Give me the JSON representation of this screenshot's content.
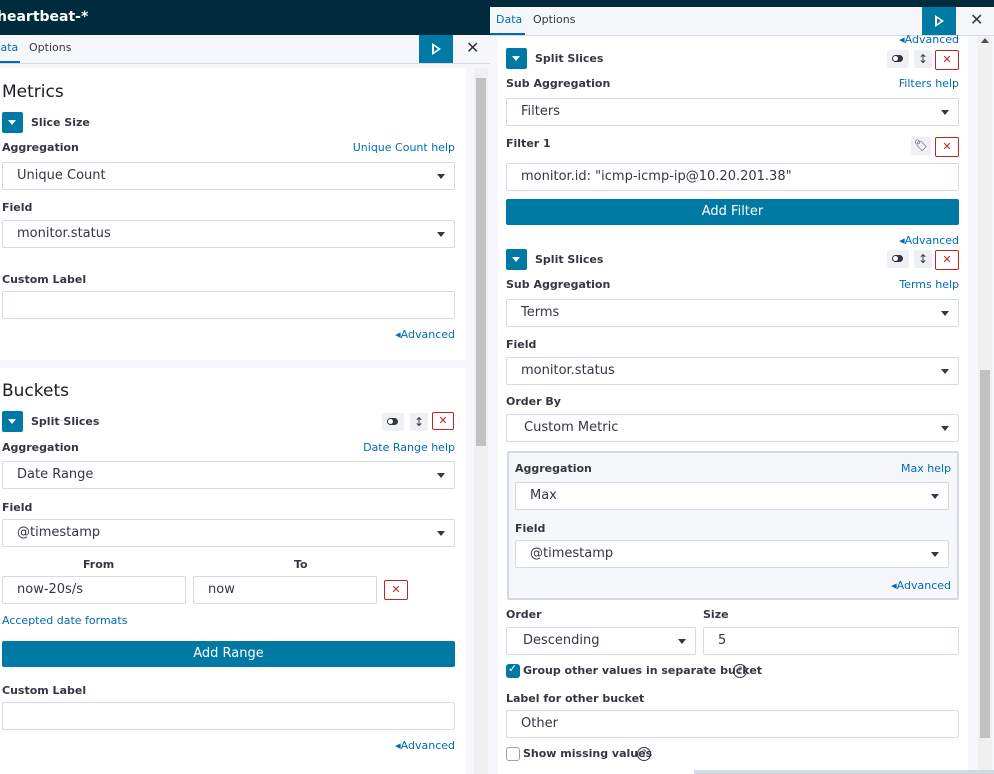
{
  "left": {
    "index_title": "heartbeat-*",
    "tabs": [
      "Data",
      "Options"
    ],
    "metrics": {
      "title": "Metrics",
      "agg_title": "Slice Size",
      "aggregation_label": "Aggregation",
      "aggregation_help": "Unique Count help",
      "aggregation_value": "Unique Count",
      "field_label": "Field",
      "field_value": "monitor.status",
      "custom_label": "Custom Label",
      "custom_value": "",
      "advanced": "Advanced"
    },
    "buckets": {
      "title": "Buckets",
      "agg_title": "Split Slices",
      "aggregation_label": "Aggregation",
      "aggregation_help": "Date Range help",
      "aggregation_value": "Date Range",
      "field_label": "Field",
      "field_value": "@timestamp",
      "from_label": "From",
      "to_label": "To",
      "from_value": "now-20s/s",
      "to_value": "now",
      "date_formats_link": "Accepted date formats",
      "add_range": "Add Range",
      "custom_label": "Custom Label",
      "custom_value": "",
      "advanced": "Advanced"
    }
  },
  "right": {
    "tabs": [
      "Data",
      "Options"
    ],
    "top_advanced": "Advanced",
    "split1": {
      "title": "Split Slices",
      "sub_agg_label": "Sub Aggregation",
      "sub_agg_help": "Filters help",
      "sub_agg_value": "Filters",
      "filter_label": "Filter 1",
      "filter_value": "monitor.id: \"icmp-icmp-ip@10.20.201.38\"",
      "add_filter": "Add Filter",
      "advanced": "Advanced"
    },
    "split2": {
      "title": "Split Slices",
      "sub_agg_label": "Sub Aggregation",
      "sub_agg_help": "Terms help",
      "sub_agg_value": "Terms",
      "field_label": "Field",
      "field_value": "monitor.status",
      "order_by_label": "Order By",
      "order_by_value": "Custom Metric",
      "inner": {
        "aggregation_label": "Aggregation",
        "aggregation_help": "Max help",
        "aggregation_value": "Max",
        "field_label": "Field",
        "field_value": "@timestamp",
        "advanced": "Advanced"
      },
      "order_label": "Order",
      "order_value": "Descending",
      "size_label": "Size",
      "size_value": "5",
      "group_other_label": "Group other values in separate bucket",
      "group_other_checked": true,
      "other_bucket_label": "Label for other bucket",
      "other_bucket_value": "Other",
      "show_missing_label": "Show missing values",
      "show_missing_checked": false
    }
  },
  "colors": {
    "header_bg": "#002b3d",
    "primary": "#0079a5",
    "link": "#006bb4",
    "danger": "#bd271e",
    "panel_bg": "#f5f7fa",
    "border": "#d3dae6"
  }
}
